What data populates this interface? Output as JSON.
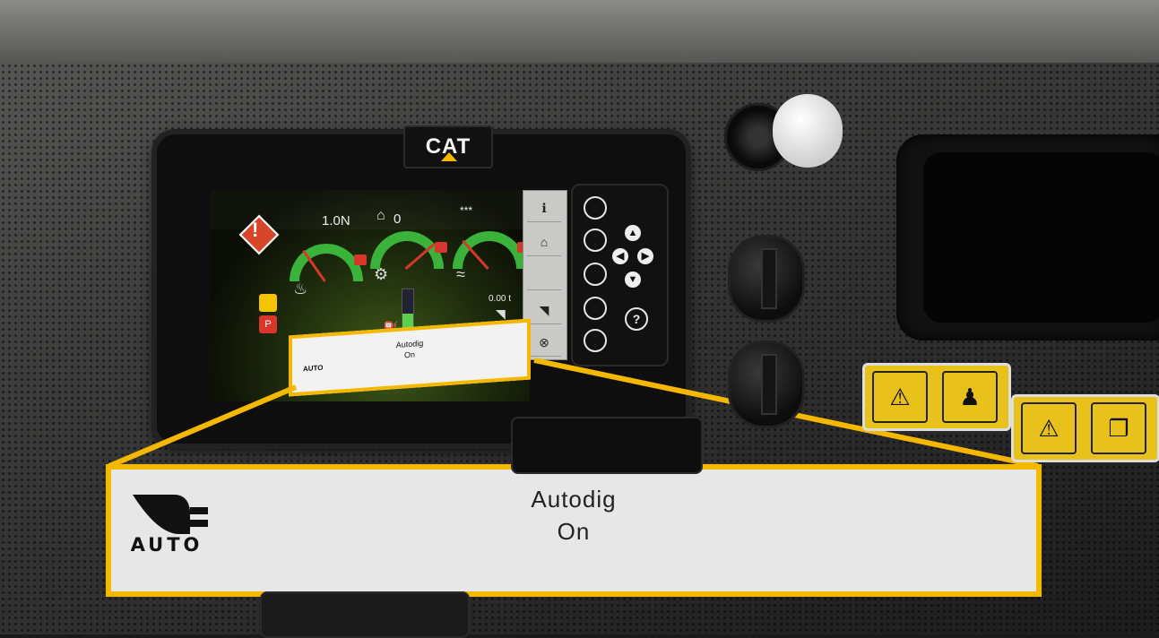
{
  "brand": {
    "logo_text": "CAT"
  },
  "status_bar": {
    "gear": "1.0N",
    "rpm_value": "0",
    "rpm_icon": "engine-rpm-icon",
    "stars": "***",
    "warning_icon": "warning-diamond-icon"
  },
  "gauges": [
    {
      "icon": "coolant-temp-icon",
      "level": 0.25
    },
    {
      "icon": "transmission-temp-icon",
      "level": 0.85
    },
    {
      "icon": "hydraulic-temp-icon",
      "level": 0.2
    }
  ],
  "fuel": {
    "icon": "fuel-icon",
    "level": 0.6
  },
  "payload": {
    "value": "0.00 t",
    "icon": "bucket-icon"
  },
  "side_icons": [
    "brake-icon",
    "parking-brake-icon"
  ],
  "screen_keys": [
    "info-icon",
    "engine-icon",
    "blank",
    "bucket-auto-icon",
    "cancel-icon"
  ],
  "keypad": {
    "buttons_count_label": "",
    "help_label": "?"
  },
  "banner_small": {
    "title": "Autodig",
    "state": "On",
    "icon_label": "AUTO"
  },
  "callout": {
    "title": "Autodig",
    "state": "On",
    "icon_label": "AUTO",
    "icon": "bucket-auto-icon"
  },
  "colors": {
    "accent": "#f5b800",
    "gauge_green": "#3bb23a",
    "gauge_red": "#d8362a",
    "warning": "#d8462a"
  }
}
